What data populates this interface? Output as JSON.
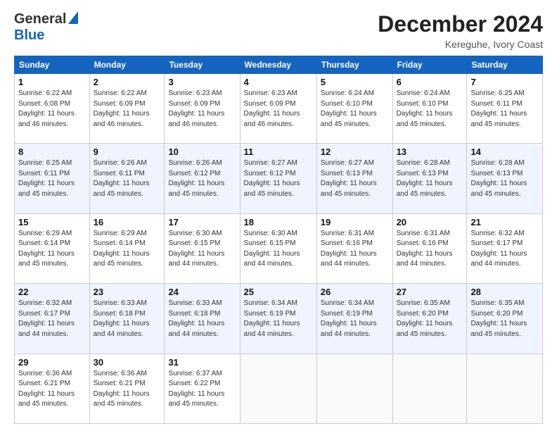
{
  "header": {
    "logo_line1": "General",
    "logo_line2": "Blue",
    "month_title": "December 2024",
    "location": "Kereguhe, Ivory Coast"
  },
  "weekdays": [
    "Sunday",
    "Monday",
    "Tuesday",
    "Wednesday",
    "Thursday",
    "Friday",
    "Saturday"
  ],
  "weeks": [
    [
      {
        "day": "1",
        "info": "Sunrise: 6:22 AM\nSunset: 6:08 PM\nDaylight: 11 hours\nand 46 minutes."
      },
      {
        "day": "2",
        "info": "Sunrise: 6:22 AM\nSunset: 6:09 PM\nDaylight: 11 hours\nand 46 minutes."
      },
      {
        "day": "3",
        "info": "Sunrise: 6:23 AM\nSunset: 6:09 PM\nDaylight: 11 hours\nand 46 minutes."
      },
      {
        "day": "4",
        "info": "Sunrise: 6:23 AM\nSunset: 6:09 PM\nDaylight: 11 hours\nand 46 minutes."
      },
      {
        "day": "5",
        "info": "Sunrise: 6:24 AM\nSunset: 6:10 PM\nDaylight: 11 hours\nand 45 minutes."
      },
      {
        "day": "6",
        "info": "Sunrise: 6:24 AM\nSunset: 6:10 PM\nDaylight: 11 hours\nand 45 minutes."
      },
      {
        "day": "7",
        "info": "Sunrise: 6:25 AM\nSunset: 6:11 PM\nDaylight: 11 hours\nand 45 minutes."
      }
    ],
    [
      {
        "day": "8",
        "info": "Sunrise: 6:25 AM\nSunset: 6:11 PM\nDaylight: 11 hours\nand 45 minutes."
      },
      {
        "day": "9",
        "info": "Sunrise: 6:26 AM\nSunset: 6:11 PM\nDaylight: 11 hours\nand 45 minutes."
      },
      {
        "day": "10",
        "info": "Sunrise: 6:26 AM\nSunset: 6:12 PM\nDaylight: 11 hours\nand 45 minutes."
      },
      {
        "day": "11",
        "info": "Sunrise: 6:27 AM\nSunset: 6:12 PM\nDaylight: 11 hours\nand 45 minutes."
      },
      {
        "day": "12",
        "info": "Sunrise: 6:27 AM\nSunset: 6:13 PM\nDaylight: 11 hours\nand 45 minutes."
      },
      {
        "day": "13",
        "info": "Sunrise: 6:28 AM\nSunset: 6:13 PM\nDaylight: 11 hours\nand 45 minutes."
      },
      {
        "day": "14",
        "info": "Sunrise: 6:28 AM\nSunset: 6:13 PM\nDaylight: 11 hours\nand 45 minutes."
      }
    ],
    [
      {
        "day": "15",
        "info": "Sunrise: 6:29 AM\nSunset: 6:14 PM\nDaylight: 11 hours\nand 45 minutes."
      },
      {
        "day": "16",
        "info": "Sunrise: 6:29 AM\nSunset: 6:14 PM\nDaylight: 11 hours\nand 45 minutes."
      },
      {
        "day": "17",
        "info": "Sunrise: 6:30 AM\nSunset: 6:15 PM\nDaylight: 11 hours\nand 44 minutes."
      },
      {
        "day": "18",
        "info": "Sunrise: 6:30 AM\nSunset: 6:15 PM\nDaylight: 11 hours\nand 44 minutes."
      },
      {
        "day": "19",
        "info": "Sunrise: 6:31 AM\nSunset: 6:16 PM\nDaylight: 11 hours\nand 44 minutes."
      },
      {
        "day": "20",
        "info": "Sunrise: 6:31 AM\nSunset: 6:16 PM\nDaylight: 11 hours\nand 44 minutes."
      },
      {
        "day": "21",
        "info": "Sunrise: 6:32 AM\nSunset: 6:17 PM\nDaylight: 11 hours\nand 44 minutes."
      }
    ],
    [
      {
        "day": "22",
        "info": "Sunrise: 6:32 AM\nSunset: 6:17 PM\nDaylight: 11 hours\nand 44 minutes."
      },
      {
        "day": "23",
        "info": "Sunrise: 6:33 AM\nSunset: 6:18 PM\nDaylight: 11 hours\nand 44 minutes."
      },
      {
        "day": "24",
        "info": "Sunrise: 6:33 AM\nSunset: 6:18 PM\nDaylight: 11 hours\nand 44 minutes."
      },
      {
        "day": "25",
        "info": "Sunrise: 6:34 AM\nSunset: 6:19 PM\nDaylight: 11 hours\nand 44 minutes."
      },
      {
        "day": "26",
        "info": "Sunrise: 6:34 AM\nSunset: 6:19 PM\nDaylight: 11 hours\nand 44 minutes."
      },
      {
        "day": "27",
        "info": "Sunrise: 6:35 AM\nSunset: 6:20 PM\nDaylight: 11 hours\nand 45 minutes."
      },
      {
        "day": "28",
        "info": "Sunrise: 6:35 AM\nSunset: 6:20 PM\nDaylight: 11 hours\nand 45 minutes."
      }
    ],
    [
      {
        "day": "29",
        "info": "Sunrise: 6:36 AM\nSunset: 6:21 PM\nDaylight: 11 hours\nand 45 minutes."
      },
      {
        "day": "30",
        "info": "Sunrise: 6:36 AM\nSunset: 6:21 PM\nDaylight: 11 hours\nand 45 minutes."
      },
      {
        "day": "31",
        "info": "Sunrise: 6:37 AM\nSunset: 6:22 PM\nDaylight: 11 hours\nand 45 minutes."
      },
      null,
      null,
      null,
      null
    ]
  ]
}
